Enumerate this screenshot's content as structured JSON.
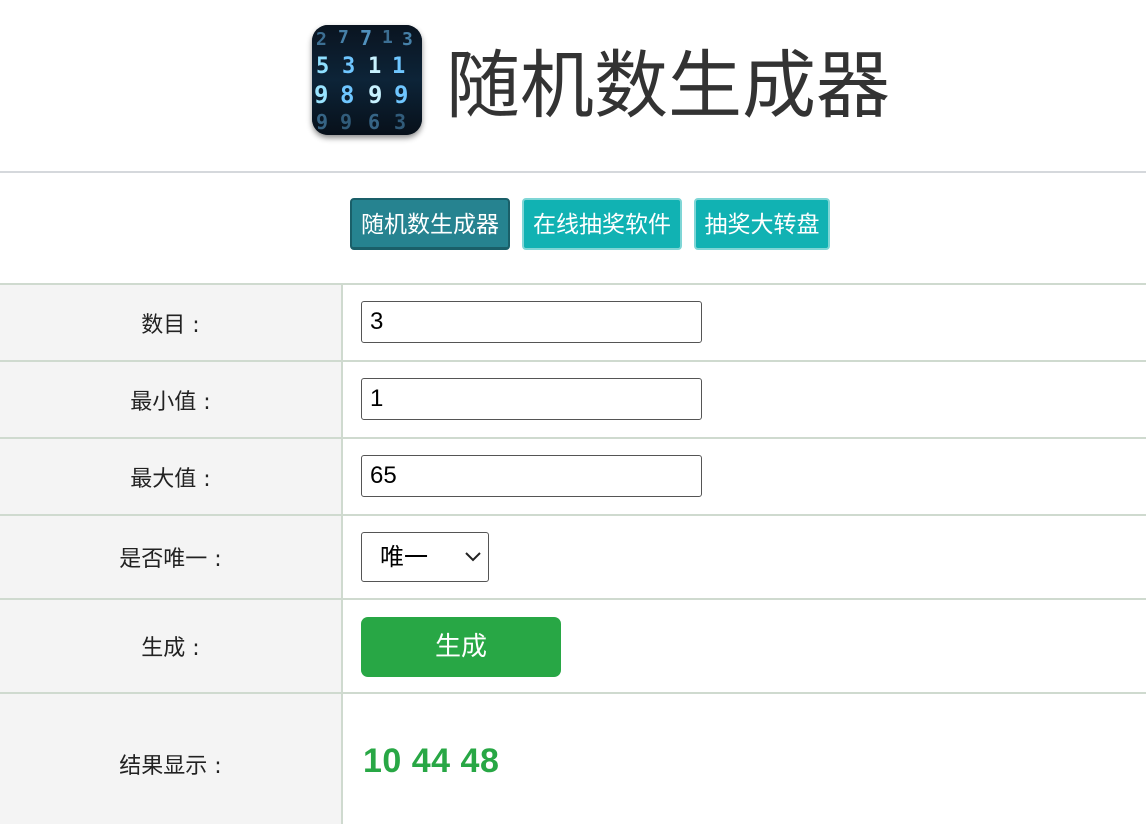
{
  "header": {
    "title": "随机数生成器",
    "logo_icon": "number-matrix-icon"
  },
  "nav": {
    "items": [
      {
        "label": "随机数生成器",
        "active": true
      },
      {
        "label": "在线抽奖软件",
        "active": false
      },
      {
        "label": "抽奖大转盘",
        "active": false
      }
    ]
  },
  "form": {
    "count": {
      "label": "数目 :",
      "value": "3"
    },
    "min": {
      "label": "最小值 :",
      "value": "1"
    },
    "max": {
      "label": "最大值 :",
      "value": "65"
    },
    "unique": {
      "label": "是否唯一 :",
      "selected": "唯一"
    },
    "generate": {
      "label": "生成 :",
      "button_label": "生成"
    },
    "result": {
      "label": "结果显示 :",
      "value": "10 44 48"
    }
  },
  "colors": {
    "nav_active": "#268390",
    "nav_normal": "#11b2b3",
    "accent_green": "#28a745",
    "label_bg": "#f4f4f4",
    "divider": "#cfdacf"
  }
}
